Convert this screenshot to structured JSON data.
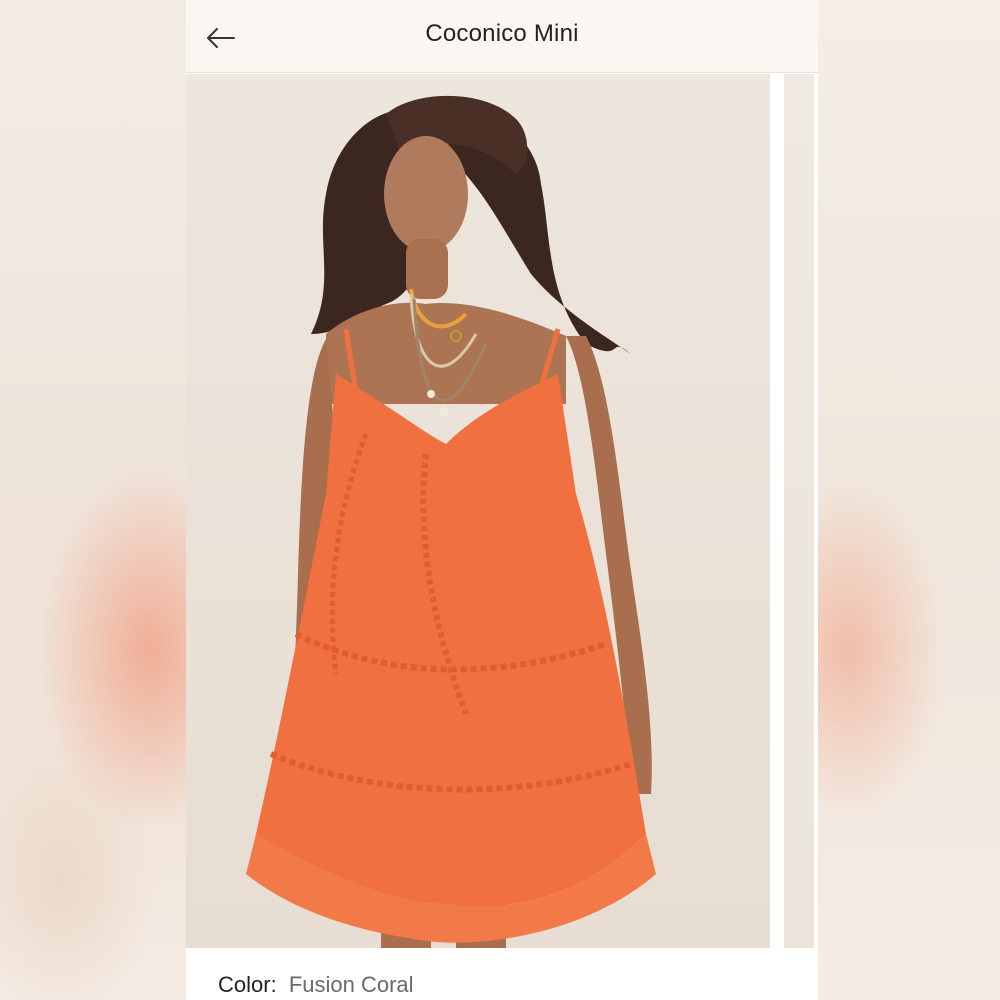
{
  "header": {
    "title": "Coconico Mini",
    "back_icon": "arrow-left-icon"
  },
  "product": {
    "image_alt": "Model wearing an orange ruffled tiered mini dress",
    "dress_color": "#f0703f",
    "color_label": "Color:",
    "color_value": "Fusion Coral"
  }
}
